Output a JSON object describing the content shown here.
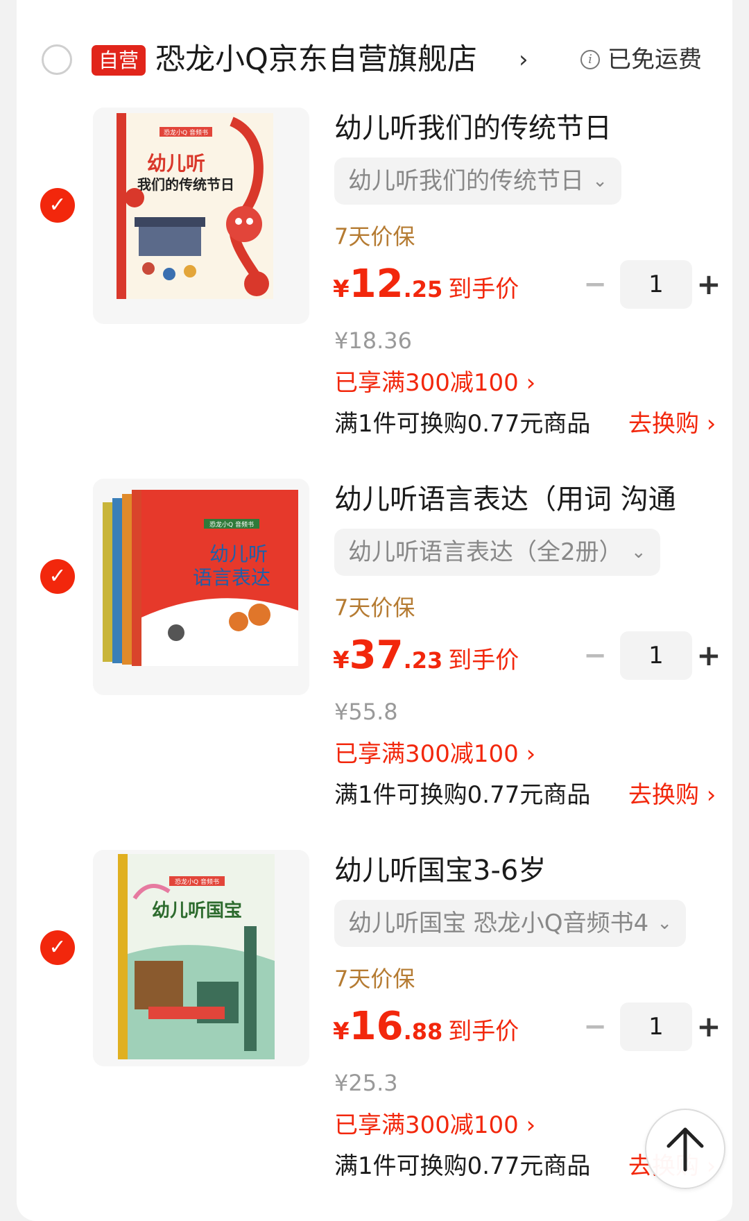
{
  "shop": {
    "self_tag": "自营",
    "name": "恐龙小Q京东自营旗舰店",
    "chevron": "›",
    "shipping_info_icon": "info-icon",
    "shipping": "已免运费"
  },
  "items": [
    {
      "title": "幼儿听我们的传统节日",
      "spec": "幼儿听我们的传统节日",
      "guarantee": "7天价保",
      "price": {
        "symbol": "¥",
        "int": "12",
        "dec": ".25",
        "label": "到手价"
      },
      "qty": "1",
      "original_price": "¥18.36",
      "discount": "已享满300减100 ›",
      "swap_text": "满1件可换购0.77元商品",
      "swap_link": "去换购 ›",
      "cover_texts": {
        "brand": "恐龙小Q 音频书",
        "line1": "幼儿听",
        "line2": "我们的传统节日"
      }
    },
    {
      "title": "幼儿听语言表达（用词 沟通",
      "spec": "幼儿听语言表达（全2册）",
      "guarantee": "7天价保",
      "price": {
        "symbol": "¥",
        "int": "37",
        "dec": ".23",
        "label": "到手价"
      },
      "qty": "1",
      "original_price": "¥55.8",
      "discount": "已享满300减100 ›",
      "swap_text": "满1件可换购0.77元商品",
      "swap_link": "去换购 ›",
      "cover_texts": {
        "brand": "恐龙小Q 音频书",
        "line1": "幼儿听",
        "line2": "语言表达"
      }
    },
    {
      "title": "幼儿听国宝3-6岁",
      "spec": "幼儿听国宝 恐龙小Q音频书4",
      "guarantee": "7天价保",
      "price": {
        "symbol": "¥",
        "int": "16",
        "dec": ".88",
        "label": "到手价"
      },
      "qty": "1",
      "original_price": "¥25.3",
      "discount": "已享满300减100 ›",
      "swap_text": "满1件可换购0.77元商品",
      "swap_link": "去换购 ›",
      "cover_texts": {
        "brand": "恐龙小Q 音频书",
        "line1": "幼儿听国宝",
        "line2": ""
      }
    }
  ],
  "controls": {
    "minus": "−",
    "plus": "+",
    "check": "✓",
    "spec_chevron": "⌄"
  },
  "colors": {
    "accent_red": "#f2270c",
    "guarantee_gold": "#b57b32",
    "muted_gray": "#999999"
  }
}
